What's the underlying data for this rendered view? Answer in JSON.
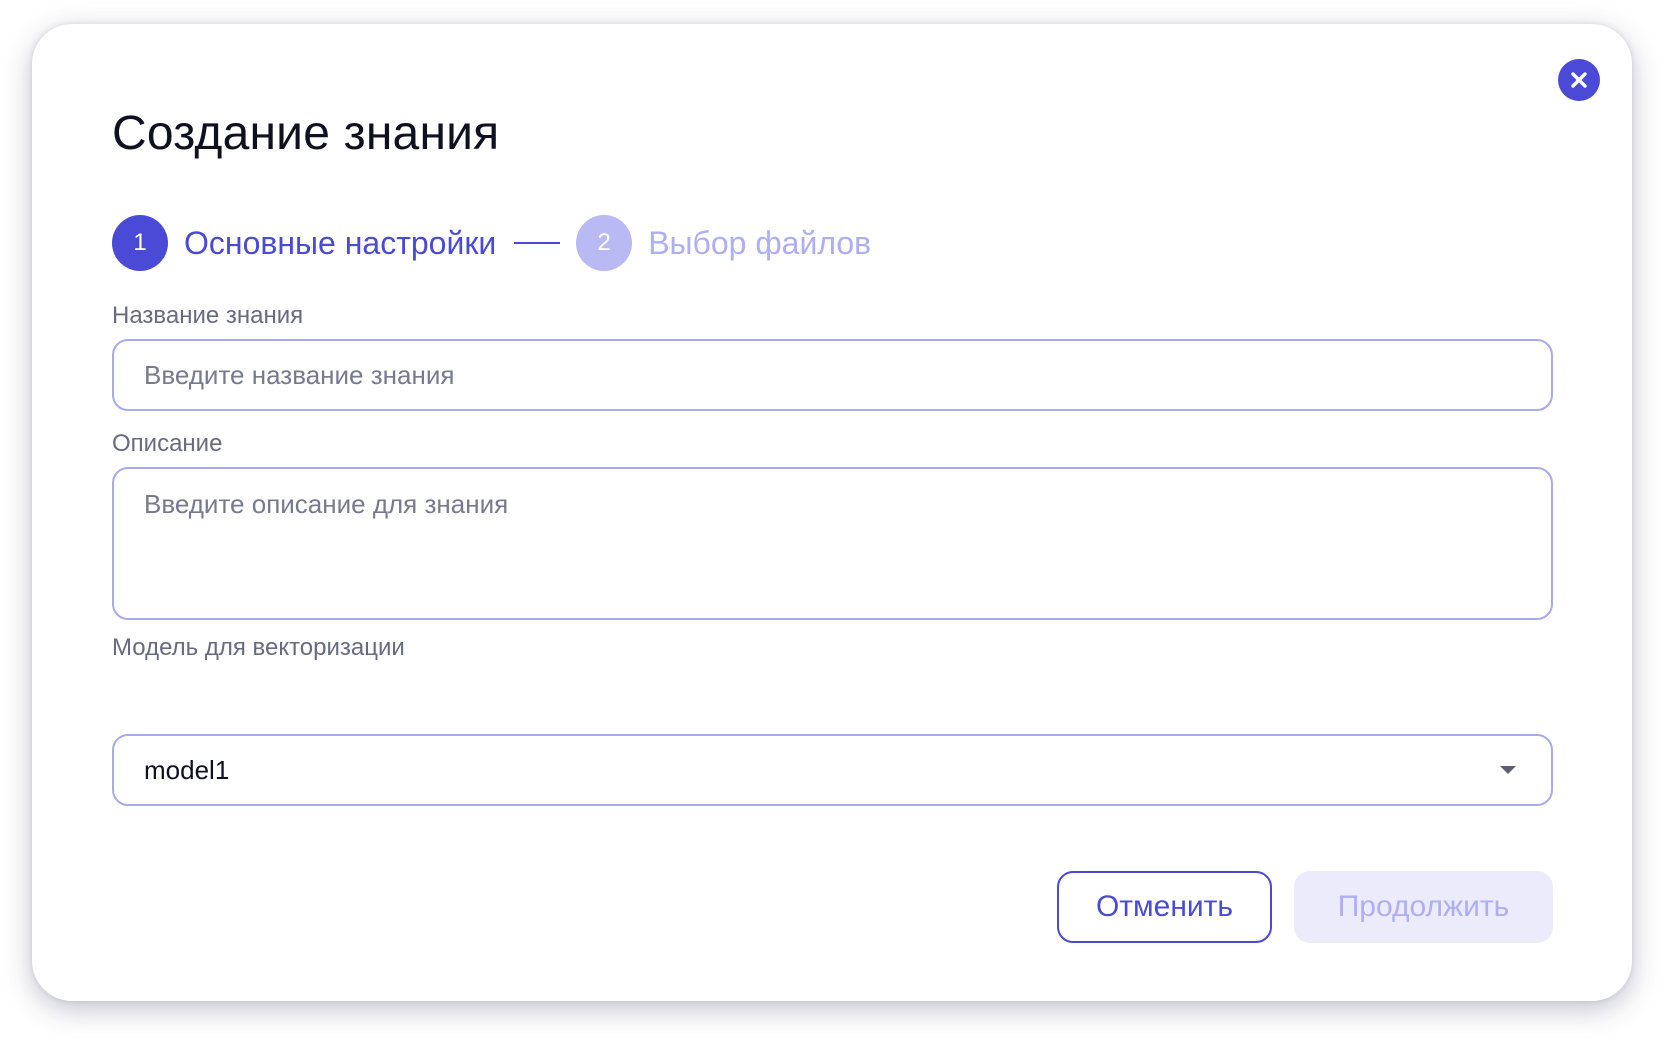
{
  "dialog": {
    "title": "Создание знания"
  },
  "stepper": {
    "steps": [
      {
        "number": "1",
        "label": "Основные настройки",
        "state": "active"
      },
      {
        "number": "2",
        "label": "Выбор файлов",
        "state": "inactive"
      }
    ]
  },
  "form": {
    "name": {
      "label": "Название знания",
      "value": "",
      "placeholder": "Введите название знания"
    },
    "description": {
      "label": "Описание",
      "value": "",
      "placeholder": "Введите описание для знания"
    },
    "model": {
      "label": "Модель для векторизации",
      "selected": "model1"
    }
  },
  "actions": {
    "cancel_label": "Отменить",
    "continue_label": "Продолжить"
  },
  "icons": {
    "close": "close-icon",
    "dropdown": "chevron-down-icon"
  },
  "colors": {
    "accent": "#4a4ad6",
    "accent_light": "#b9b9f3",
    "border": "#a9a9ec",
    "disabled_bg": "#ebebfc"
  }
}
